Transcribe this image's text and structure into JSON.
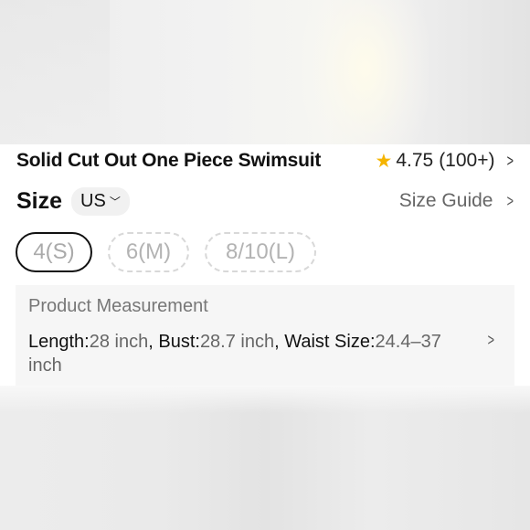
{
  "product": {
    "title": "Solid Cut Out One Piece Swimsuit",
    "rating": "4.75",
    "review_count": "(100+)"
  },
  "size": {
    "label": "Size",
    "region": "US",
    "guide_label": "Size Guide",
    "options": [
      {
        "label": "4(S)",
        "selected": true
      },
      {
        "label": "6(M)",
        "selected": false
      },
      {
        "label": "8/10(L)",
        "selected": false
      }
    ]
  },
  "measurement": {
    "heading": "Product Measurement",
    "length_key": "Length:",
    "length_val": "28 inch",
    "bust_key": "Bust:",
    "bust_val": "28.7 inch",
    "waist_key": "Waist Size:",
    "waist_val": "24.4–37",
    "unit_tail": "inch"
  },
  "icons": {
    "star": "star-icon",
    "chevron": "chevron-right-icon",
    "dropdown": "chevron-down-icon"
  },
  "colors": {
    "star": "#f5b400",
    "selected_border": "#111111",
    "measurement_bg": "#f6f6f6"
  }
}
